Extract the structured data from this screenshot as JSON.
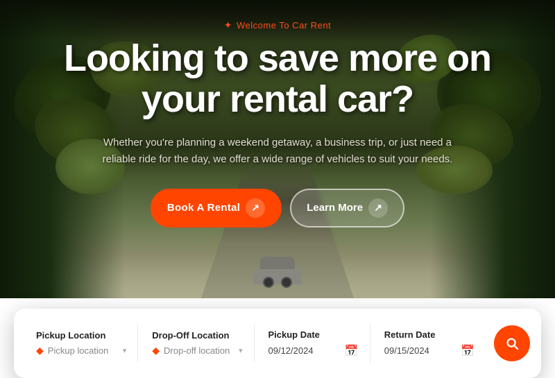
{
  "hero": {
    "welcome_text": "Welcome To Car Rent",
    "title_line1": "Looking to save more on",
    "title_line2": "your rental car?",
    "subtitle": "Whether you're planning a weekend getaway, a business trip, or just need a reliable ride for the day, we offer a wide range of vehicles to suit your needs.",
    "btn_book": "Book A Rental",
    "btn_learn": "Learn More",
    "arrow_symbol": "↗"
  },
  "search": {
    "pickup_location_label": "Pickup Location",
    "pickup_location_placeholder": "Pickup location",
    "dropoff_location_label": "Drop-Off Location",
    "dropoff_location_placeholder": "Drop-off location",
    "pickup_date_label": "Pickup Date",
    "pickup_date_value": "09/12/2024",
    "return_date_label": "Return Date",
    "return_date_value": "09/15/2024"
  },
  "colors": {
    "accent": "#ff4500",
    "accent_light": "#ff6a30",
    "white": "#ffffff",
    "text_dark": "#222222",
    "text_muted": "#888888"
  }
}
